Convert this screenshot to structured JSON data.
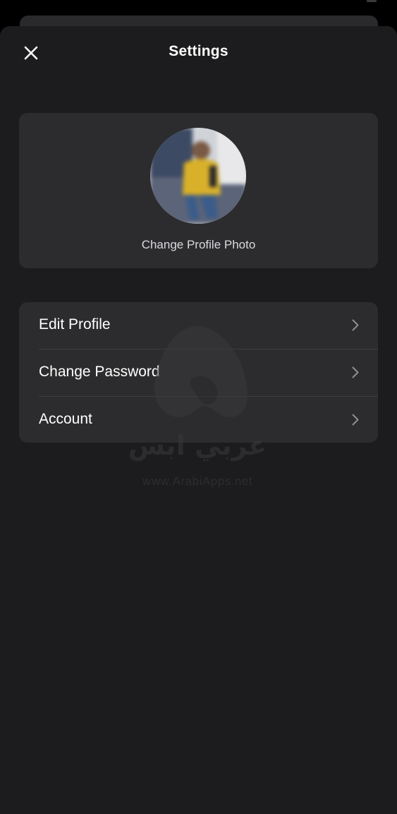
{
  "header": {
    "title": "Settings",
    "close_icon": "close-icon"
  },
  "profile": {
    "change_photo_label": "Change Profile Photo",
    "avatar_icon": "avatar-photo"
  },
  "menu": {
    "items": [
      {
        "label": "Edit Profile",
        "icon": "chevron-right-icon"
      },
      {
        "label": "Change Password",
        "icon": "chevron-right-icon"
      },
      {
        "label": "Account",
        "icon": "chevron-right-icon"
      }
    ]
  },
  "watermark": {
    "arabic_text": "عربي ابس",
    "url_text": "www.ArabiApps.net"
  },
  "colors": {
    "background": "#1c1c1e",
    "card": "#2c2c2e",
    "text_primary": "#ffffff",
    "text_secondary": "#d9d9de",
    "chevron": "#8e8e93"
  }
}
